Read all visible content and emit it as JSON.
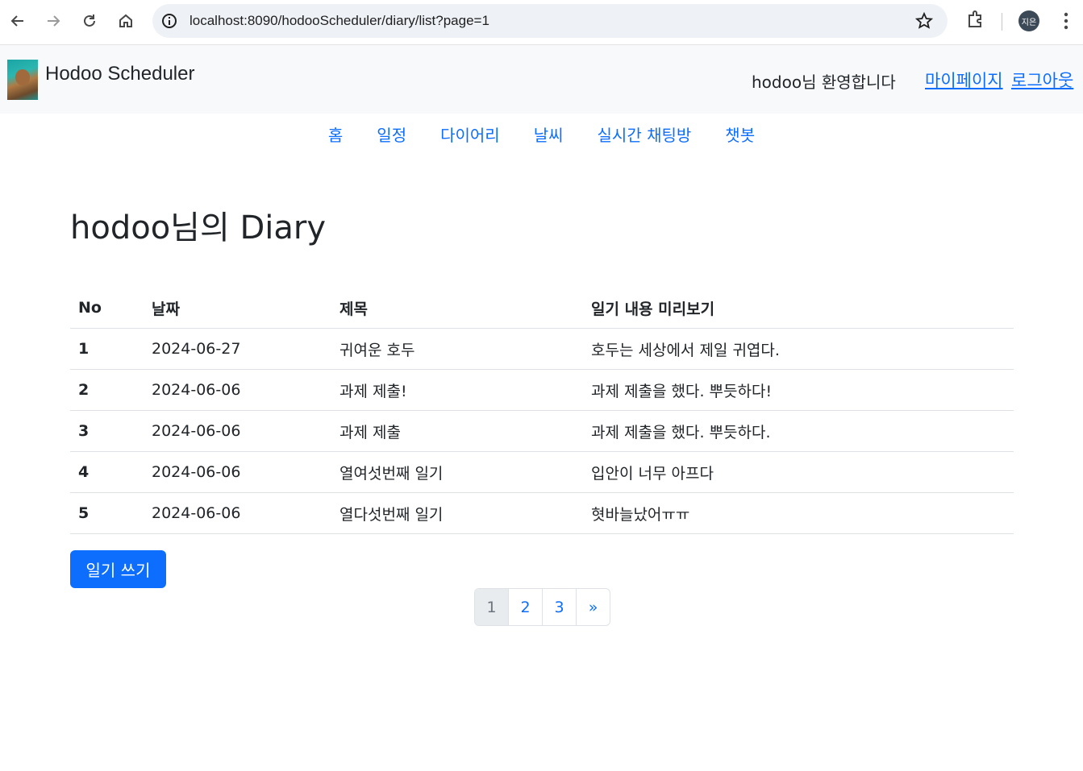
{
  "browser": {
    "url": "localhost:8090/hodooScheduler/diary/list?page=1",
    "profile_initials": "지은"
  },
  "header": {
    "brand": "Hodoo Scheduler",
    "welcome": "hodoo님 환영합니다",
    "mypage_link": "마이페이지",
    "logout_link": "로그아웃"
  },
  "nav": {
    "items": [
      "홈",
      "일정",
      "다이어리",
      "날씨",
      "실시간 채팅방",
      "챗봇"
    ]
  },
  "main": {
    "title": "hodoo님의 Diary",
    "table": {
      "headers": [
        "No",
        "날짜",
        "제목",
        "일기 내용 미리보기"
      ],
      "rows": [
        [
          "1",
          "2024-06-27",
          "귀여운 호두",
          "호두는 세상에서 제일 귀엽다."
        ],
        [
          "2",
          "2024-06-06",
          "과제 제출!",
          "과제 제출을 했다. 뿌듯하다!"
        ],
        [
          "3",
          "2024-06-06",
          "과제 제출",
          "과제 제출을 했다. 뿌듯하다."
        ],
        [
          "4",
          "2024-06-06",
          "열여섯번째 일기",
          "입안이 너무 아프다"
        ],
        [
          "5",
          "2024-06-06",
          "열다섯번째 일기",
          "혓바늘났어ㅠㅠ"
        ]
      ]
    },
    "write_button": "일기 쓰기",
    "pagination": [
      "1",
      "2",
      "3",
      "»"
    ],
    "current_page": "1"
  },
  "colors": {
    "primary": "#0d6efd",
    "header_bg": "#f8f9fa"
  }
}
